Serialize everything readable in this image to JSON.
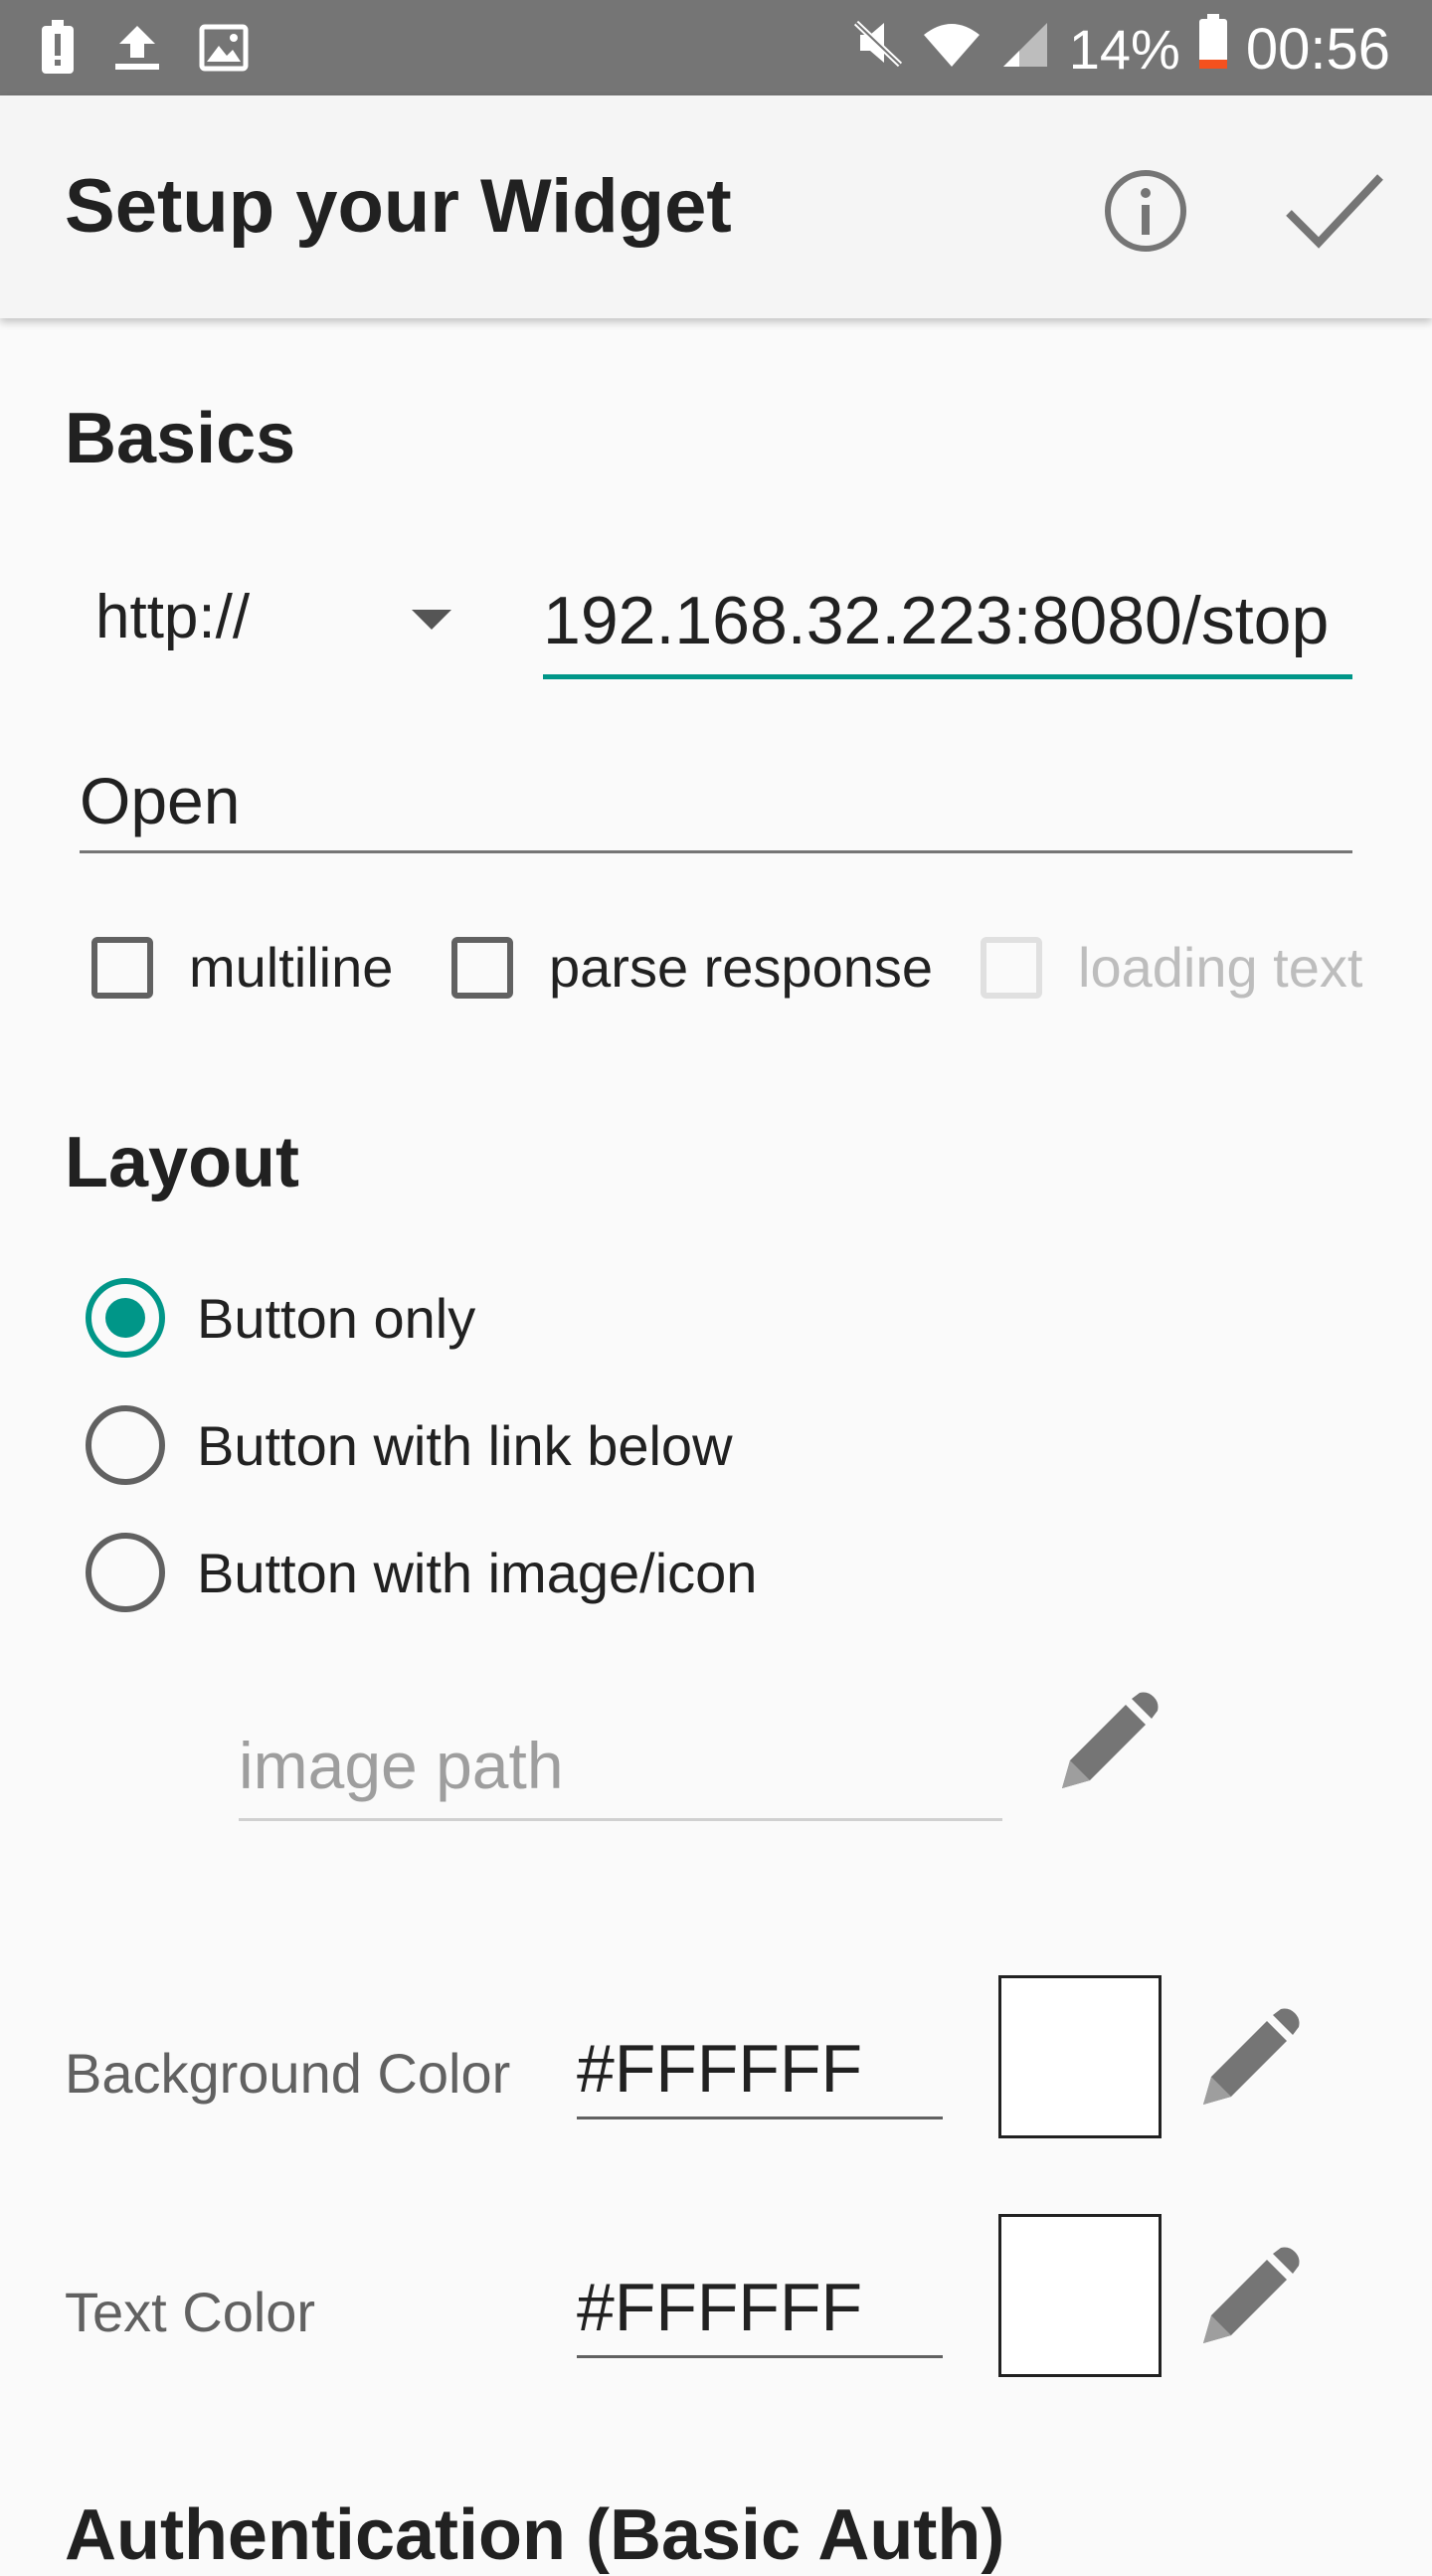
{
  "status_bar": {
    "battery_percent": "14%",
    "time": "00:56",
    "icons": [
      "alert-icon",
      "upload-icon",
      "image-icon",
      "mute-icon",
      "wifi-icon",
      "signal-icon",
      "battery-icon"
    ]
  },
  "app_bar": {
    "title": "Setup your Widget",
    "actions": [
      "info-icon",
      "checkmark-icon"
    ]
  },
  "basics": {
    "title": "Basics",
    "protocol": "http://",
    "url": "192.168.32.223:8080/stop",
    "label_value": "Open",
    "checkboxes": [
      {
        "label": "multiline",
        "checked": false,
        "enabled": true
      },
      {
        "label": "parse response",
        "checked": false,
        "enabled": true
      },
      {
        "label": "loading text",
        "checked": false,
        "enabled": false
      }
    ]
  },
  "layout": {
    "title": "Layout",
    "options": [
      {
        "label": "Button only",
        "selected": true
      },
      {
        "label": "Button with link below",
        "selected": false
      },
      {
        "label": "Button with image/icon",
        "selected": false
      }
    ],
    "image_path_placeholder": "image path"
  },
  "colors": {
    "background": {
      "label": "Background Color",
      "value": "#FFFFFF",
      "swatch": "#FFFFFF"
    },
    "text": {
      "label": "Text Color",
      "value": "#FFFFFF",
      "swatch": "#FFFFFF"
    }
  },
  "auth": {
    "title": "Authentication (Basic Auth)"
  },
  "accent_color": "#009688"
}
